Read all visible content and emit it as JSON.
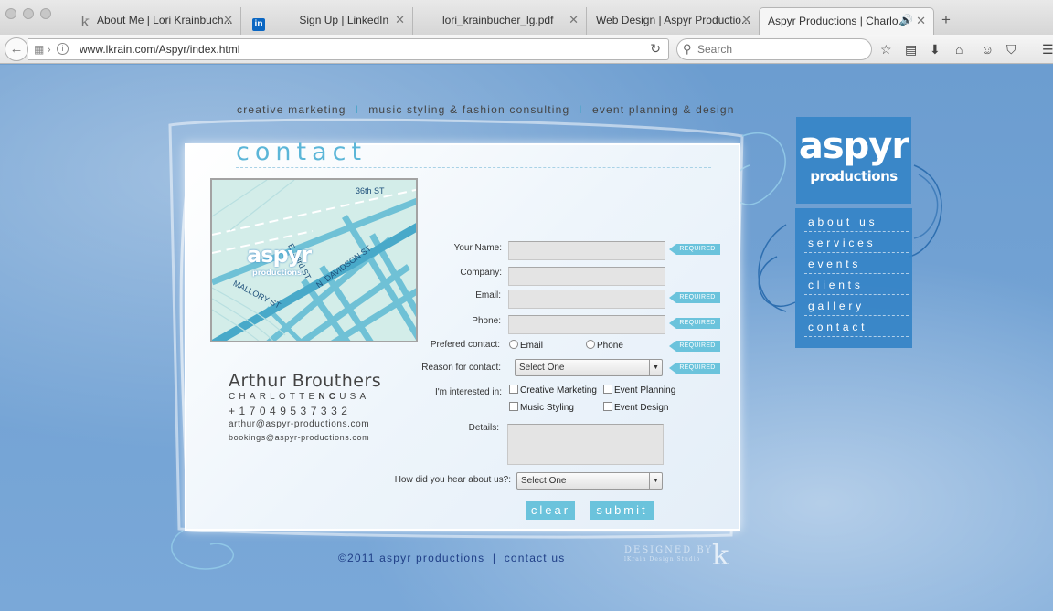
{
  "browser": {
    "tabs": [
      {
        "title": "About Me | Lori Krainbuch...",
        "favicon": "k"
      },
      {
        "title": "Sign Up | LinkedIn",
        "favicon": "linkedin"
      },
      {
        "title": "lori_krainbucher_lg.pdf",
        "favicon": ""
      },
      {
        "title": "Web Design | Aspyr Productio...",
        "favicon": ""
      },
      {
        "title": "Aspyr Productions | Charlo...",
        "favicon": "",
        "active": true
      }
    ],
    "url": "www.lkrain.com/Aspyr/index.html",
    "search_placeholder": "Search"
  },
  "site": {
    "tagline": [
      "creative marketing",
      "music styling & fashion consulting",
      "event planning & design"
    ],
    "tagline_separator": "I",
    "heading": "contact",
    "map": {
      "street_36th": "36th ST",
      "street_e33rd": "E. 33rd ST",
      "street_davidson": "N. DAVIDSON ST",
      "street_mallory": "MALLORY ST",
      "logo_main": "aspyr",
      "logo_sub": "productions"
    },
    "address": {
      "name": "Arthur Brouthers",
      "city_pre": "CHARLOTTE",
      "city_state": "NC",
      "city_post": "USA",
      "phone": "+17049537332",
      "email": "arthur@aspyr-productions.com",
      "bookings": "bookings@aspyr-productions.com"
    },
    "form": {
      "labels": {
        "name": "Your Name:",
        "company": "Company:",
        "email": "Email:",
        "phone": "Phone:",
        "preferred": "Prefered contact:",
        "reason": "Reason for contact:",
        "interested": "I'm interested in:",
        "details": "Details:",
        "hear": "How did you hear about us?:"
      },
      "required_label": "REQUIRED",
      "preferred_options": [
        "Email",
        "Phone"
      ],
      "reason_value": "Select One",
      "hear_value": "Select One",
      "interests": [
        "Creative Marketing",
        "Event Planning",
        "Music Styling",
        "Event Design"
      ],
      "clear_label": "clear",
      "submit_label": "submit"
    },
    "footer": {
      "copyright": "©2011 aspyr productions",
      "separator": "|",
      "contact_link": "contact us"
    },
    "credit": {
      "line1": "DESIGNED BY",
      "line2": "lKrain Design Studio",
      "mark": "k"
    },
    "logo": {
      "main": "aspyr",
      "sub": "productions"
    },
    "nav": [
      "about us",
      "services",
      "events",
      "clients",
      "gallery",
      "contact"
    ],
    "colors": {
      "accent": "#6bc3dc",
      "nav_bg": "#3483c7",
      "footer_text": "#1f3e86",
      "page_bg": "#6f9fd0"
    }
  }
}
